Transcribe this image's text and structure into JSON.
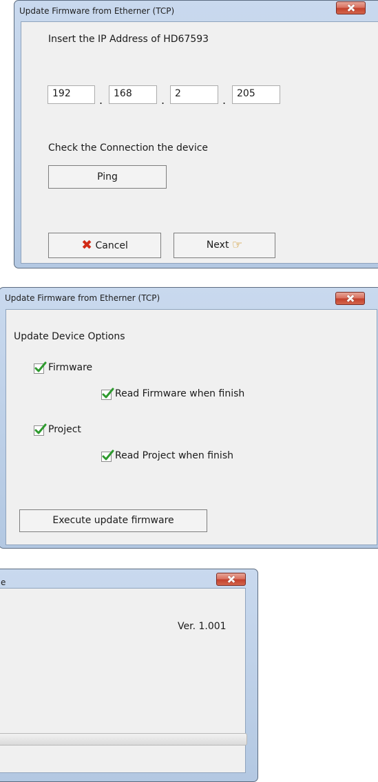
{
  "dialog1": {
    "title": "Update Firmware from Etherner (TCP)",
    "prompt": "Insert the IP Address of HD67593",
    "ip": [
      "192",
      "168",
      "2",
      "205"
    ],
    "separator": ".",
    "check_label": "Check the Connection the device",
    "ping_label": "Ping",
    "cancel_label": "Cancel",
    "next_label": "Next"
  },
  "dialog2": {
    "title": "Update Firmware from Etherner (TCP)",
    "section_label": "Update Device Options",
    "firmware_label": "Firmware",
    "read_firmware_label": "Read Firmware when finish",
    "project_label": "Project",
    "read_project_label": "Read Project when finish",
    "execute_label": "Execute update firmware"
  },
  "dialog3": {
    "title_fragment": "e",
    "version": "Ver. 1.001",
    "line_fragment": ".",
    "progress": 0
  },
  "colors": {
    "frame": "#b3c8e2",
    "client": "#f0f0f0",
    "close_button": "#c2402c",
    "checkmark": "#2e9a2e"
  }
}
